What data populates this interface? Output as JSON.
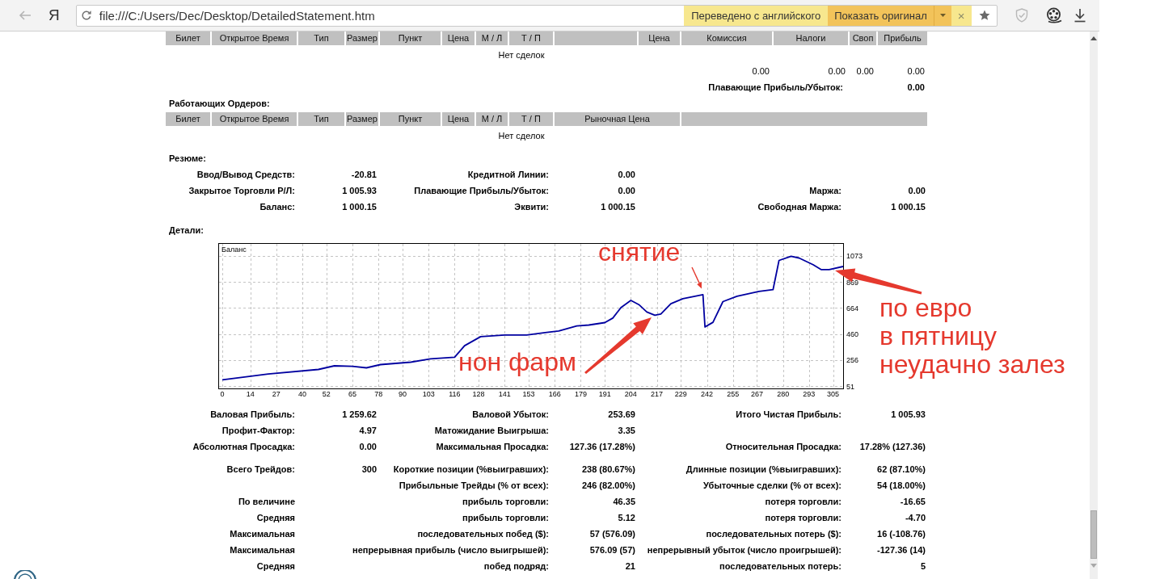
{
  "browser": {
    "logo": "Я",
    "address": "file:///C:/Users/Dec/Desktop/DetailedStatement.htm",
    "translation": {
      "status": "Переведено с английского",
      "button": "Показать оригинал",
      "close": "×"
    }
  },
  "open_trades": {
    "columns": [
      {
        "kind": "heading",
        "label": "Билет"
      },
      {
        "kind": "heading",
        "label": "Открытое Время"
      },
      {
        "kind": "heading",
        "label": "Тип"
      },
      {
        "kind": "heading",
        "label": "Размер"
      },
      {
        "kind": "heading",
        "label": "Пункт"
      },
      {
        "kind": "heading",
        "label": "Цена"
      },
      {
        "kind": "heading",
        "label": "М / Л"
      },
      {
        "kind": "heading",
        "label": "Т / П"
      },
      {
        "kind": "blank"
      },
      {
        "kind": "heading",
        "label": "Цена"
      },
      {
        "kind": "heading",
        "label": "Комиссия"
      },
      {
        "kind": "heading",
        "label": "Налоги"
      },
      {
        "kind": "heading",
        "label": "Своп"
      },
      {
        "kind": "heading",
        "label": "Прибыль"
      }
    ],
    "empty_text": "Нет сделок",
    "totals": [
      "0.00",
      "0.00",
      "0.00",
      "0.00"
    ],
    "floating": {
      "label": "Плавающие Прибыль/Убыток:",
      "value": "0.00"
    }
  },
  "working_orders": {
    "title": "Работающих Ордеров:",
    "columns": [
      {
        "kind": "heading",
        "label": "Билет"
      },
      {
        "kind": "heading",
        "label": "Открытое Время"
      },
      {
        "kind": "heading",
        "label": "Тип"
      },
      {
        "kind": "heading",
        "label": "Размер"
      },
      {
        "kind": "heading",
        "label": "Пункт"
      },
      {
        "kind": "heading",
        "label": "Цена"
      },
      {
        "kind": "heading",
        "label": "М / Л"
      },
      {
        "kind": "heading",
        "label": "Т / П"
      },
      {
        "kind": "heading",
        "label": "Рыночная Цена"
      },
      {
        "kind": "blank"
      }
    ],
    "empty_text": "Нет сделок"
  },
  "summary": {
    "title": "Резюме:",
    "rows": [
      {
        "left": {
          "label": "Ввод/Вывод Средств:",
          "value": "-20.81"
        },
        "middle": {
          "label": "Кредитной Линии:",
          "value": "0.00"
        }
      },
      {
        "left": {
          "label": "Закрытое Торговли Р/Л:",
          "value": "1 005.93"
        },
        "middle": {
          "label": "Плавающие Прибыль/Убыток:",
          "value": "0.00"
        },
        "right": {
          "label": "Маржа:",
          "value": "0.00"
        }
      },
      {
        "left": {
          "label": "Баланс:",
          "value": "1 000.15"
        },
        "middle": {
          "label": "Эквити:",
          "value": "1 000.15"
        },
        "right": {
          "label": "Свободная Маржа:",
          "value": "1 000.15"
        }
      }
    ]
  },
  "details": {
    "title": "Детали:",
    "chart_data": {
      "type": "line",
      "title": "Баланс",
      "grid": true,
      "xlim": [
        -1.6,
        310
      ],
      "ylim": [
        32,
        1168
      ],
      "xticks": [
        0,
        14,
        27,
        40,
        52,
        65,
        78,
        90,
        103,
        116,
        128,
        141,
        153,
        166,
        179,
        191,
        204,
        217,
        229,
        242,
        255,
        267,
        280,
        293,
        305
      ],
      "yticks": [
        51,
        256,
        460,
        664,
        869,
        1073
      ],
      "x": [
        0,
        23,
        48,
        56,
        65,
        72,
        79,
        94,
        104,
        116,
        121,
        129,
        141,
        152,
        162,
        168,
        177,
        183,
        191,
        195,
        199,
        204,
        208,
        212,
        216,
        219,
        224,
        230,
        240,
        241,
        245,
        250,
        257,
        268,
        275,
        278,
        284,
        288,
        295,
        299,
        303,
        310
      ],
      "series": [
        {
          "color": "#0000a0",
          "values": [
            100,
            145,
            181,
            210,
            206,
            194,
            219,
            238,
            265,
            277,
            368,
            439,
            452,
            452,
            472,
            484,
            523,
            530,
            549,
            585,
            666,
            724,
            691,
            633,
            607,
            617,
            698,
            737,
            769,
            515,
            552,
            714,
            756,
            795,
            808,
            1038,
            1070,
            1057,
            1005,
            966,
            966,
            990
          ]
        }
      ]
    }
  },
  "stats": {
    "groups": [
      {
        "rows": [
          {
            "left": {
              "label": "Валовая Прибыль:",
              "value": "1 259.62"
            },
            "middle": {
              "label": "Валовой Убыток:",
              "value": "253.69"
            },
            "right": {
              "label": "Итого Чистая Прибыль:",
              "value": "1 005.93"
            }
          },
          {
            "left": {
              "label": "Профит-Фактор:",
              "value": "4.97"
            },
            "middle": {
              "label": "Матожидание Выигрыша:",
              "value": "3.35"
            }
          },
          {
            "left": {
              "label": "Абсолютная Просадка:",
              "value": "0.00"
            },
            "middle": {
              "label": "Максимальная Просадка:",
              "value": "127.36 (17.28%)"
            },
            "right": {
              "label": "Относительная Просадка:",
              "value": "17.28% (127.36)"
            }
          }
        ]
      },
      {
        "rows": [
          {
            "left": {
              "label": "Всего Трейдов:",
              "value": "300"
            },
            "middle": {
              "label": "Короткие позиции (%выигравших):",
              "value": "238 (80.67%)"
            },
            "right": {
              "label": "Длинные позиции (%выигравших):",
              "value": "62 (87.10%)"
            }
          },
          {
            "middle": {
              "label": "Прибыльные Трейды (% от всех):",
              "value": "246 (82.00%)"
            },
            "right": {
              "label": "Убыточные сделки (% от всех):",
              "value": "54 (18.00%)"
            }
          },
          {
            "left": {
              "label": "По величине"
            },
            "middle": {
              "label": "прибыль торговли:",
              "value": "46.35"
            },
            "right": {
              "label": "потеря торговли:",
              "value": "-16.65"
            }
          },
          {
            "left": {
              "label": "Средняя"
            },
            "middle": {
              "label": "прибыль торговли:",
              "value": "5.12"
            },
            "right": {
              "label": "потеря торговли:",
              "value": "-4.70"
            }
          },
          {
            "left": {
              "label": "Максимальная"
            },
            "middle": {
              "label": "последовательных побед ($):",
              "value": "57 (576.09)"
            },
            "right": {
              "label": "последовательных потерь ($):",
              "value": "16 (-108.76)"
            }
          },
          {
            "left": {
              "label": "Максимальная"
            },
            "middle": {
              "label": "непрерывная прибыль (число выигрышей):",
              "value": "576.09 (57)"
            },
            "right": {
              "label": "непрерывный убыток (число проигрышей):",
              "value": "-127.36 (14)"
            }
          },
          {
            "left": {
              "label": "Средняя"
            },
            "middle": {
              "label": "побед подряд:",
              "value": "21"
            },
            "right": {
              "label": "последовательных потерь:",
              "value": "5"
            }
          }
        ]
      }
    ]
  },
  "annotations": [
    {
      "lines": [
        "снятие"
      ]
    },
    {
      "lines": [
        "нон фарм"
      ]
    },
    {
      "lines": [
        "по евро",
        "в пятницу",
        "неудачно залез"
      ]
    }
  ]
}
